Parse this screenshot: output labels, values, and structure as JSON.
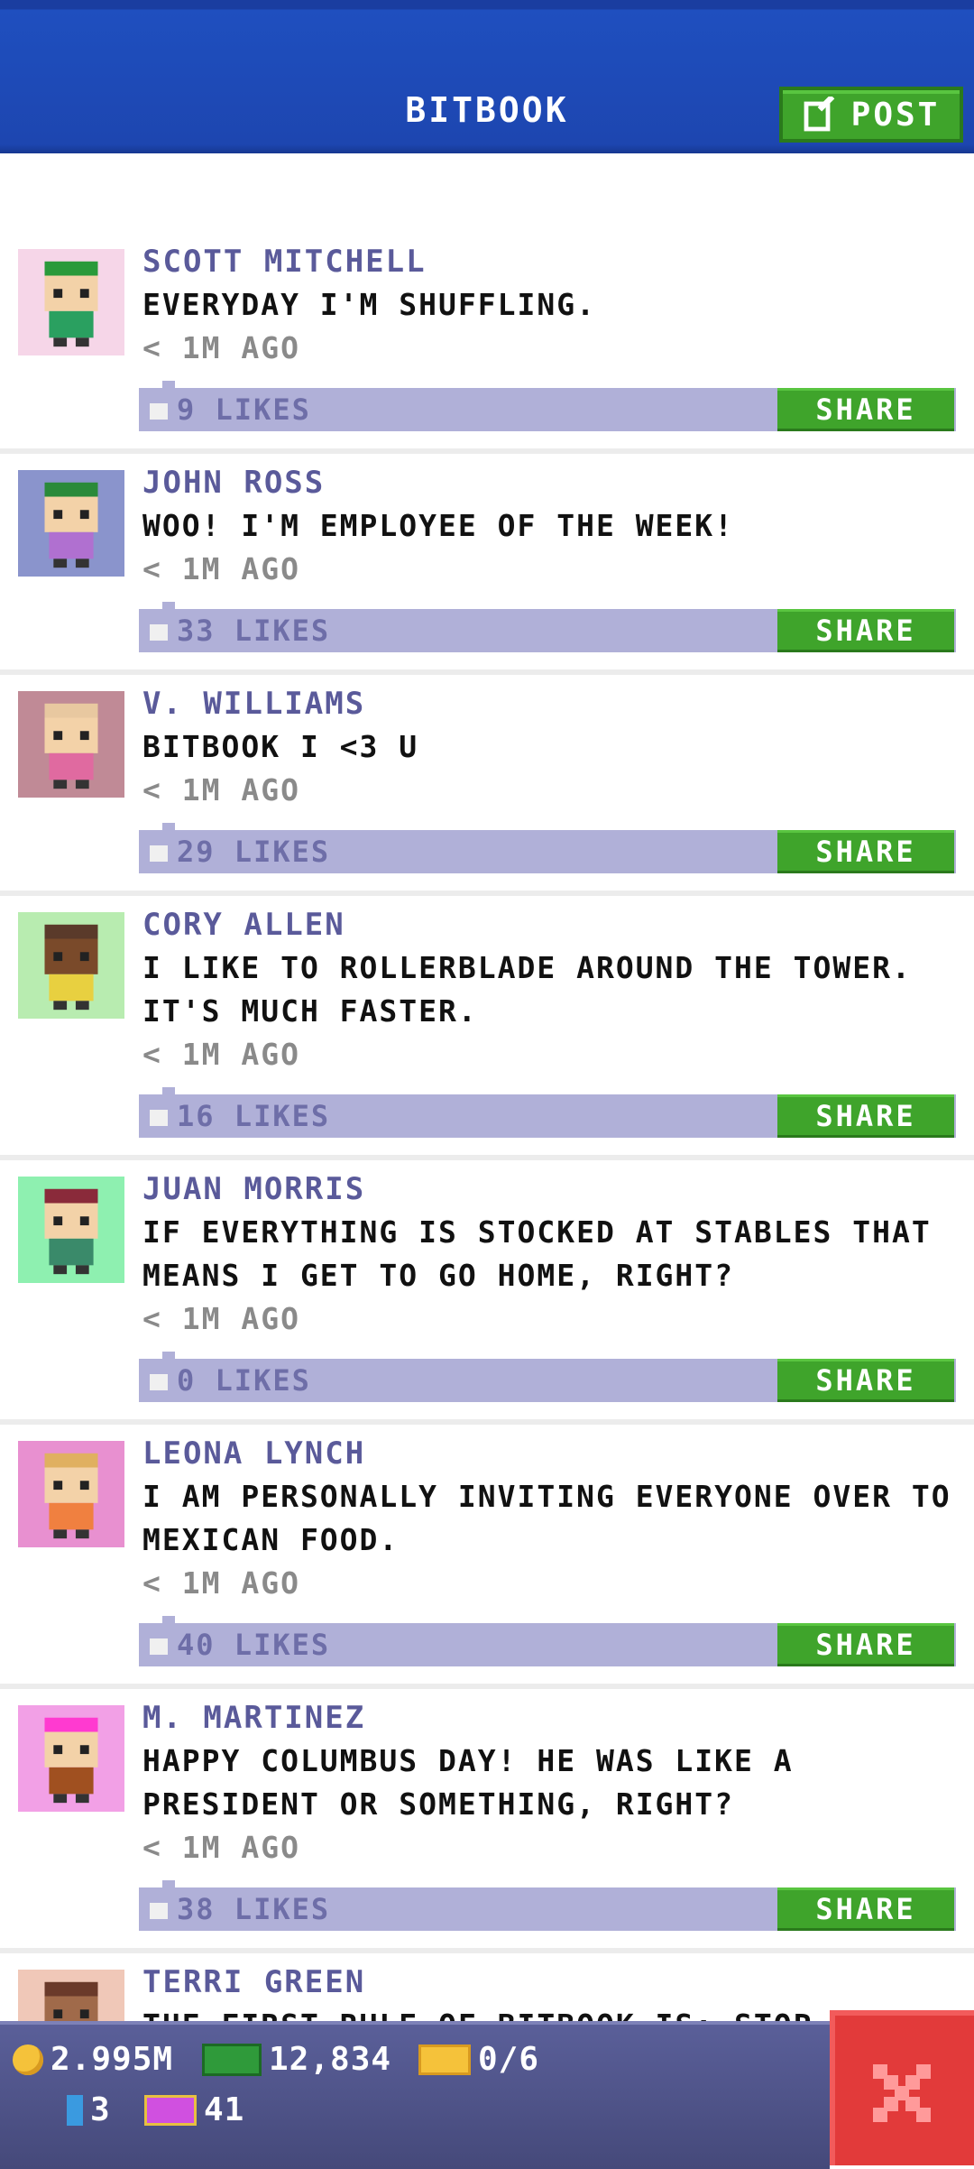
{
  "header": {
    "title": "BITBOOK",
    "post_label": "POST"
  },
  "posts": [
    {
      "name": "SCOTT MITCHELL",
      "message": "EVERYDAY I'M SHUFFLING.",
      "time": "< 1M AGO",
      "likes": "9 LIKES",
      "share": "SHARE",
      "avatar_bg": "#f6d6e8",
      "hat": "#2a9a3a",
      "skin": "#f3d2a8",
      "shirt": "#2aa060"
    },
    {
      "name": "JOHN ROSS",
      "message": "WOO! I'M EMPLOYEE OF THE WEEK!",
      "time": "< 1M AGO",
      "likes": "33 LIKES",
      "share": "SHARE",
      "avatar_bg": "#8a94cc",
      "hat": "#2a8a3a",
      "skin": "#f3d2a8",
      "shirt": "#b070d0"
    },
    {
      "name": "V. WILLIAMS",
      "message": "BITBOOK I <3 U",
      "time": "< 1M AGO",
      "likes": "29 LIKES",
      "share": "SHARE",
      "avatar_bg": "#c08a96",
      "hat": "#e8c8a0",
      "skin": "#f3d2a8",
      "shirt": "#e06aa0"
    },
    {
      "name": "CORY ALLEN",
      "message": "I LIKE TO ROLLERBLADE AROUND THE TOWER. IT'S MUCH FASTER.",
      "time": "< 1M AGO",
      "likes": "16 LIKES",
      "share": "SHARE",
      "avatar_bg": "#b8ecb0",
      "hat": "#5a3a2a",
      "skin": "#7a4a2a",
      "shirt": "#e8d040"
    },
    {
      "name": "JUAN MORRIS",
      "message": "IF EVERYTHING IS STOCKED AT STABLES THAT MEANS I GET TO GO HOME, RIGHT?",
      "time": "< 1M AGO",
      "likes": "0 LIKES",
      "share": "SHARE",
      "avatar_bg": "#8ef0b0",
      "hat": "#8a2a3a",
      "skin": "#f3d2a8",
      "shirt": "#3a8a6a"
    },
    {
      "name": "LEONA LYNCH",
      "message": "I AM PERSONALLY INVITING EVERYONE OVER TO MEXICAN FOOD.",
      "time": "< 1M AGO",
      "likes": "40 LIKES",
      "share": "SHARE",
      "avatar_bg": "#e890d0",
      "hat": "#e0b060",
      "skin": "#f3d2a8",
      "shirt": "#f08040"
    },
    {
      "name": "M. MARTINEZ",
      "message": "HAPPY COLUMBUS DAY! HE WAS LIKE A PRESIDENT OR SOMETHING, RIGHT?",
      "time": "< 1M AGO",
      "likes": "38 LIKES",
      "share": "SHARE",
      "avatar_bg": "#f2a0e6",
      "hat": "#ff3ad0",
      "skin": "#f3d2a8",
      "shirt": "#a05020"
    },
    {
      "name": "TERRI GREEN",
      "message": "THE FIRST RULE OF BITBOOK IS: STOP",
      "time": "",
      "likes": "",
      "share": "",
      "avatar_bg": "#f0c8b8",
      "hat": "#6a3a2a",
      "skin": "#a06a4a",
      "shirt": "#6060a0"
    }
  ],
  "footer": {
    "coins": "2.995M",
    "bux": "12,834",
    "tickets": "0/6",
    "floors": "3",
    "vip": "41"
  }
}
